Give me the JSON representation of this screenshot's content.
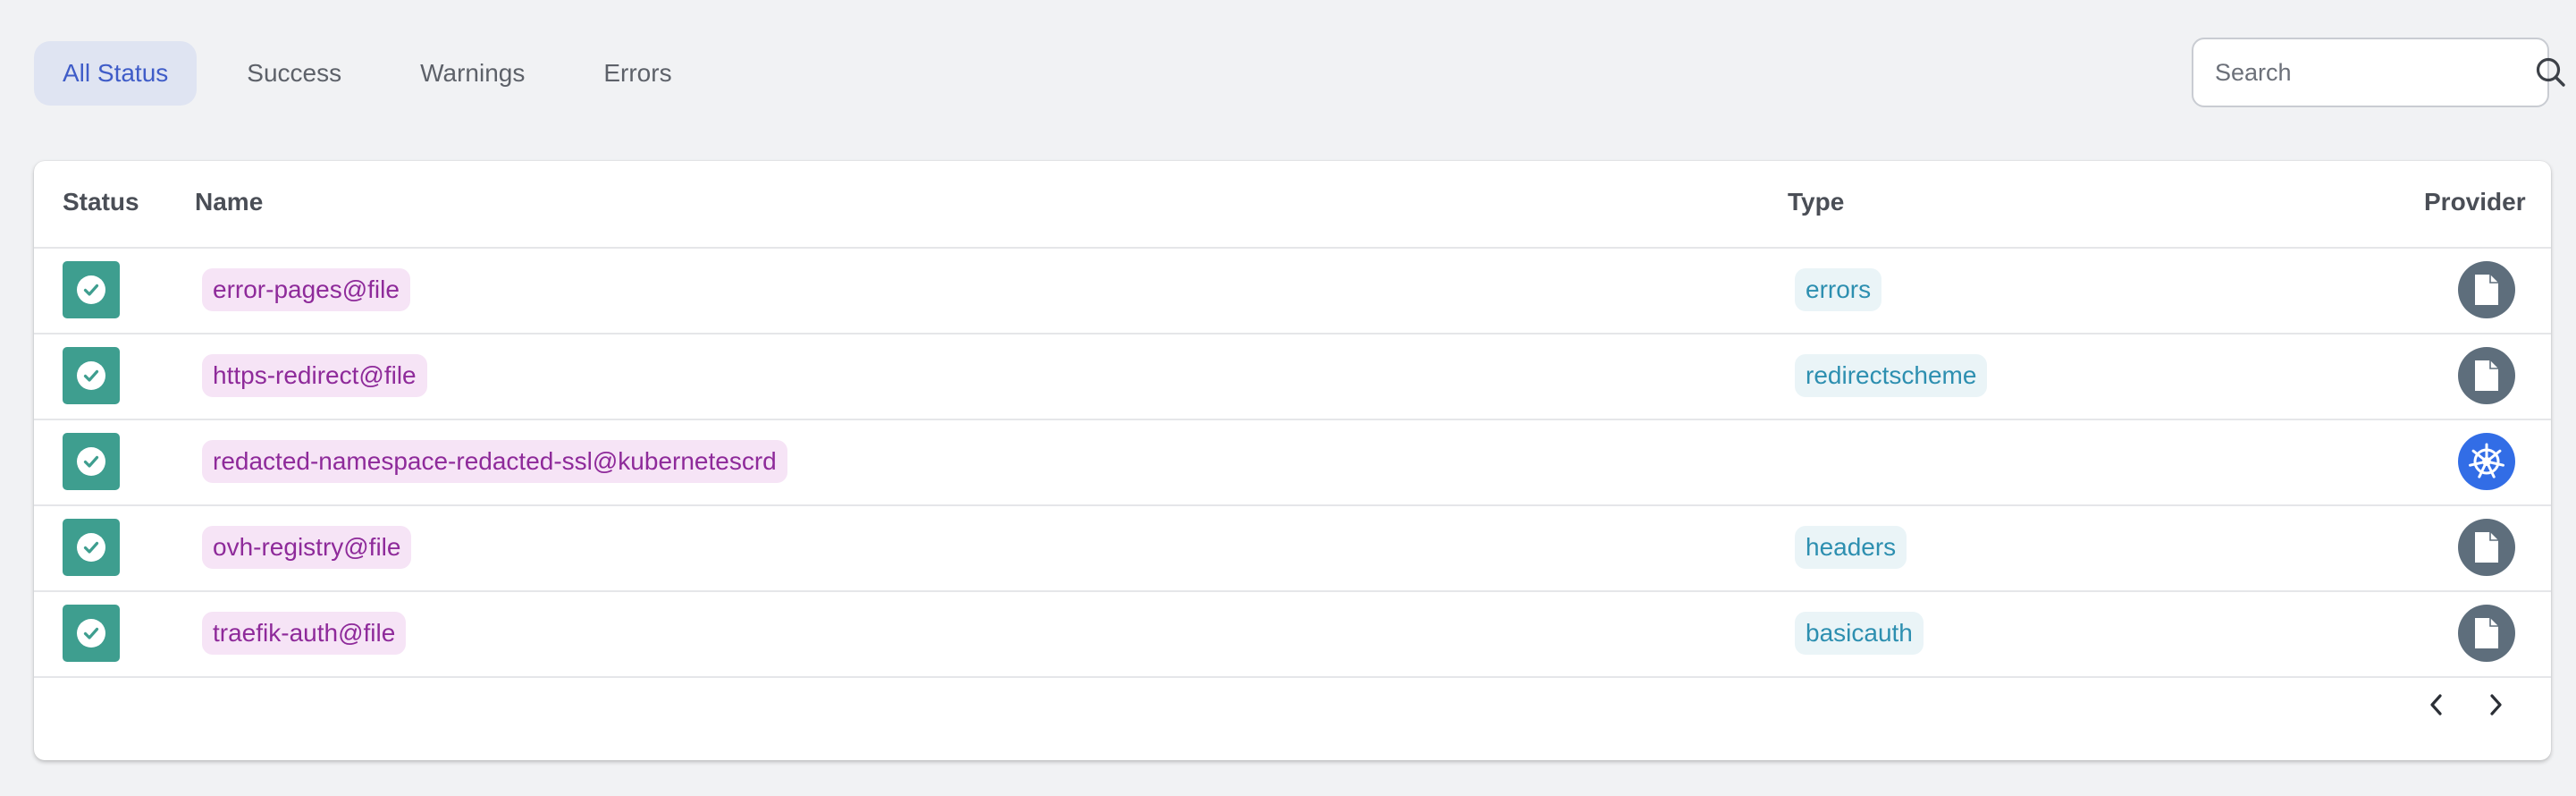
{
  "filters": {
    "tabs": [
      {
        "label": "All Status",
        "active": true
      },
      {
        "label": "Success",
        "active": false
      },
      {
        "label": "Warnings",
        "active": false
      },
      {
        "label": "Errors",
        "active": false
      }
    ]
  },
  "search": {
    "placeholder": "Search",
    "value": "",
    "icon": "search-icon"
  },
  "table": {
    "headers": {
      "status": "Status",
      "name": "Name",
      "type": "Type",
      "provider": "Provider"
    },
    "rows": [
      {
        "status": "success",
        "name": "error-pages@file",
        "type": "errors",
        "provider": "file"
      },
      {
        "status": "success",
        "name": "https-redirect@file",
        "type": "redirectscheme",
        "provider": "file"
      },
      {
        "status": "success",
        "name": "redacted-namespace-redacted-ssl@kubernetescrd",
        "type": "",
        "provider": "kubernetes"
      },
      {
        "status": "success",
        "name": "ovh-registry@file",
        "type": "headers",
        "provider": "file"
      },
      {
        "status": "success",
        "name": "traefik-auth@file",
        "type": "basicauth",
        "provider": "file"
      }
    ]
  },
  "pagination": {
    "prev_icon": "chevron-left-icon",
    "next_icon": "chevron-right-icon"
  },
  "colors": {
    "active_tab_bg": "#dfe4f2",
    "active_tab_text": "#3f5cc8",
    "success": "#3e9e8f",
    "name_chip_bg": "#f6e4f6",
    "name_chip_text": "#8e2a9a",
    "type_chip_bg": "#eaf4f7",
    "type_chip_text": "#2d8fb0",
    "provider_file": "#5e6e7c",
    "provider_kubernetes": "#326de6"
  }
}
